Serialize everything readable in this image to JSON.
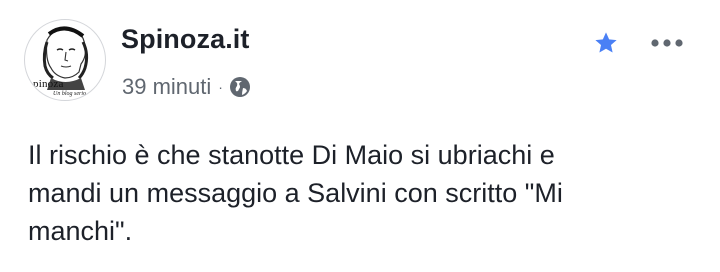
{
  "post": {
    "author": {
      "name": "Spinoza.it",
      "avatar_caption": "pinoza",
      "avatar_subcaption": "Un blog serio"
    },
    "meta": {
      "timestamp": "39 minuti",
      "separator": "·",
      "privacy_icon": "globe-icon"
    },
    "actions": {
      "favorite_icon": "star-icon",
      "favorite_color": "#4a80f5",
      "more_icon": "more-icon"
    },
    "text_lines": [
      "Il rischio è che stanotte Di Maio si ubriachi e",
      "mandi un messaggio a Salvini con scritto \"Mi",
      "manchi\"."
    ]
  }
}
